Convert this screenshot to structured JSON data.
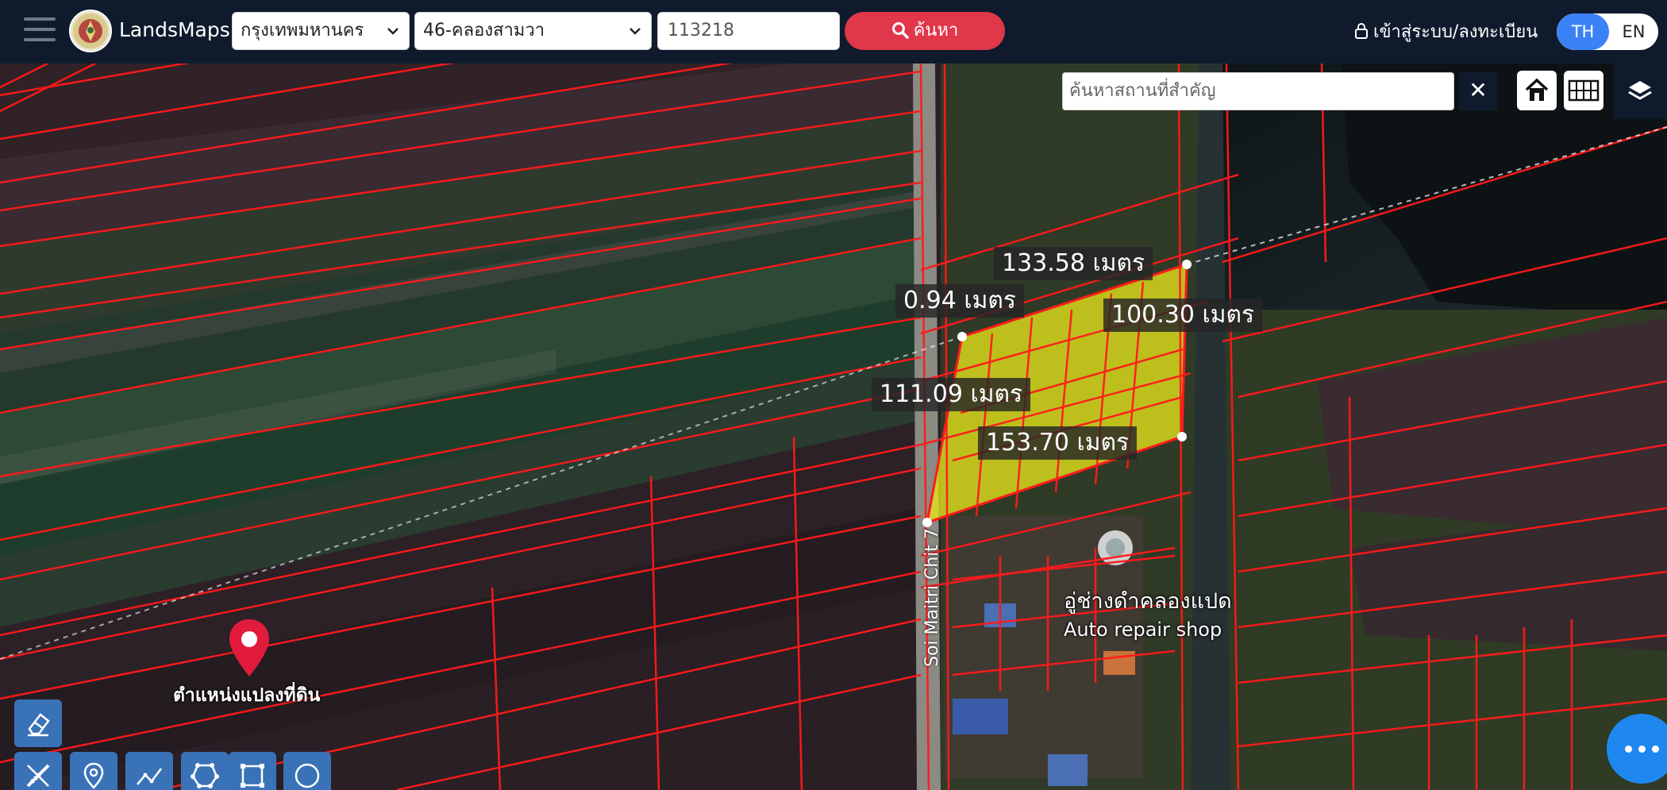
{
  "header": {
    "brand": "LandsMaps",
    "province_select": "กรุงเทพมหานคร",
    "district_select": "46-คลองสามวา",
    "parcel_number": "113218",
    "search_label": "ค้นหา",
    "login_label": "เข้าสู่ระบบ/ลงทะเบียน",
    "lang_th": "TH",
    "lang_en": "EN"
  },
  "map_controls": {
    "landmark_search_placeholder": "ค้นหาสถานที่สำคัญ",
    "clear_symbol": "✕"
  },
  "measurements": {
    "top": "133.58 เมตร",
    "small": "0.94 เมตร",
    "right": "100.30 เมตร",
    "left": "111.09 เมตร",
    "bottom": "153.70 เมตร"
  },
  "map_labels": {
    "road": "Soi Maitri Chit 7",
    "shop_th": "อู่ช่างดำคลองแปด",
    "shop_en": "Auto repair shop",
    "pin_label": "ตำแหน่งแปลงที่ดิน"
  },
  "icons": {
    "menu": "hamburger-icon",
    "search": "search-icon",
    "lock": "lock-icon",
    "home": "home-icon",
    "grid": "grid-icon",
    "layers": "layers-icon",
    "eraser": "eraser-icon",
    "ruler": "ruler-icon",
    "pin": "map-pin-icon",
    "line": "polyline-icon",
    "polygon": "polygon-icon",
    "rectangle": "rectangle-icon",
    "circle": "circle-icon",
    "chat": "chat-icon"
  },
  "colors": {
    "topbar": "#0f1b2d",
    "search_button": "#e0374a",
    "parcel_lines": "#ff1a1a",
    "selected_parcel": "#e6e619",
    "lang_active": "#3b82f6"
  }
}
